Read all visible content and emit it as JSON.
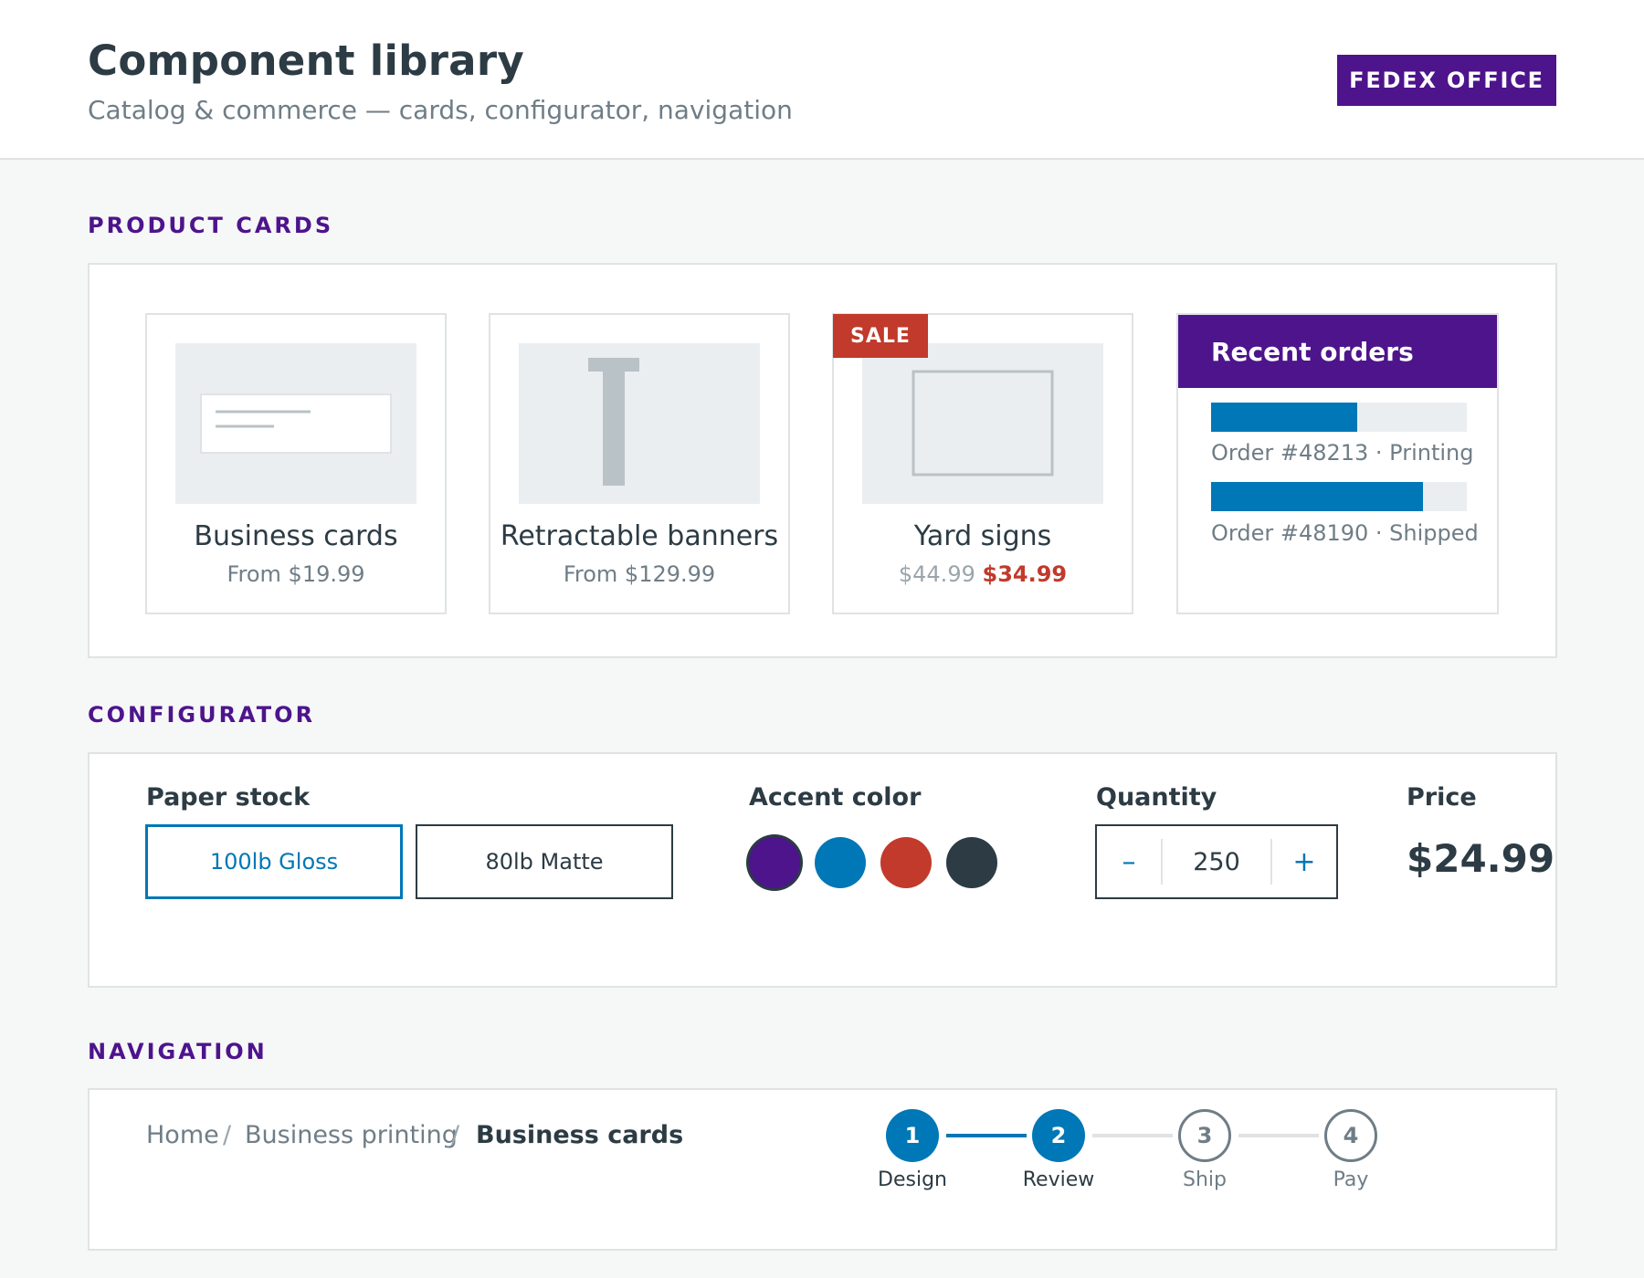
{
  "header": {
    "title": "Component library",
    "subtitle": "Catalog & commerce — cards, configurator, navigation",
    "brand": "FEDEX OFFICE"
  },
  "sections": {
    "products": "PRODUCT CARDS",
    "configurator": "CONFIGURATOR",
    "navigation": "NAVIGATION"
  },
  "products": [
    {
      "title": "Business cards",
      "price": "From $19.99",
      "image_icon": "business-card-icon"
    },
    {
      "title": "Retractable banners",
      "price": "From $129.99",
      "image_icon": "banner-stand-icon"
    },
    {
      "title": "Yard signs",
      "old_price": "$44.99",
      "sale_price": "$34.99",
      "badge": "SALE",
      "image_icon": "yard-sign-icon"
    }
  ],
  "orders": {
    "title": "Recent orders",
    "items": [
      {
        "label": "Order #48213 · Printing",
        "progress": 0.57
      },
      {
        "label": "Order #48190 · Shipped",
        "progress": 0.83
      }
    ]
  },
  "configurator": {
    "paper_label": "Paper stock",
    "paper_options": [
      "100lb Gloss",
      "80lb Matte"
    ],
    "paper_selected": "100lb Gloss",
    "color_label": "Accent color",
    "colors": [
      "#4d148c",
      "#0077b6",
      "#c13a2b",
      "#2c3b44"
    ],
    "color_selected": "#4d148c",
    "quantity_label": "Quantity",
    "quantity": "250",
    "decrement": "–",
    "increment": "+",
    "price_label": "Price",
    "price": "$24.99"
  },
  "navigation": {
    "breadcrumb": [
      "Home",
      "Business printing",
      "Business cards"
    ],
    "separator": "/",
    "steps": [
      {
        "number": "1",
        "label": "Design",
        "state": "complete"
      },
      {
        "number": "2",
        "label": "Review",
        "state": "current"
      },
      {
        "number": "3",
        "label": "Ship",
        "state": "upcoming"
      },
      {
        "number": "4",
        "label": "Pay",
        "state": "upcoming"
      }
    ]
  },
  "colors": {
    "brand": "#4d148c",
    "accent": "#0077b6",
    "sale": "#c13a2b",
    "text": "#2c3b44",
    "muted": "#6f7d86"
  }
}
